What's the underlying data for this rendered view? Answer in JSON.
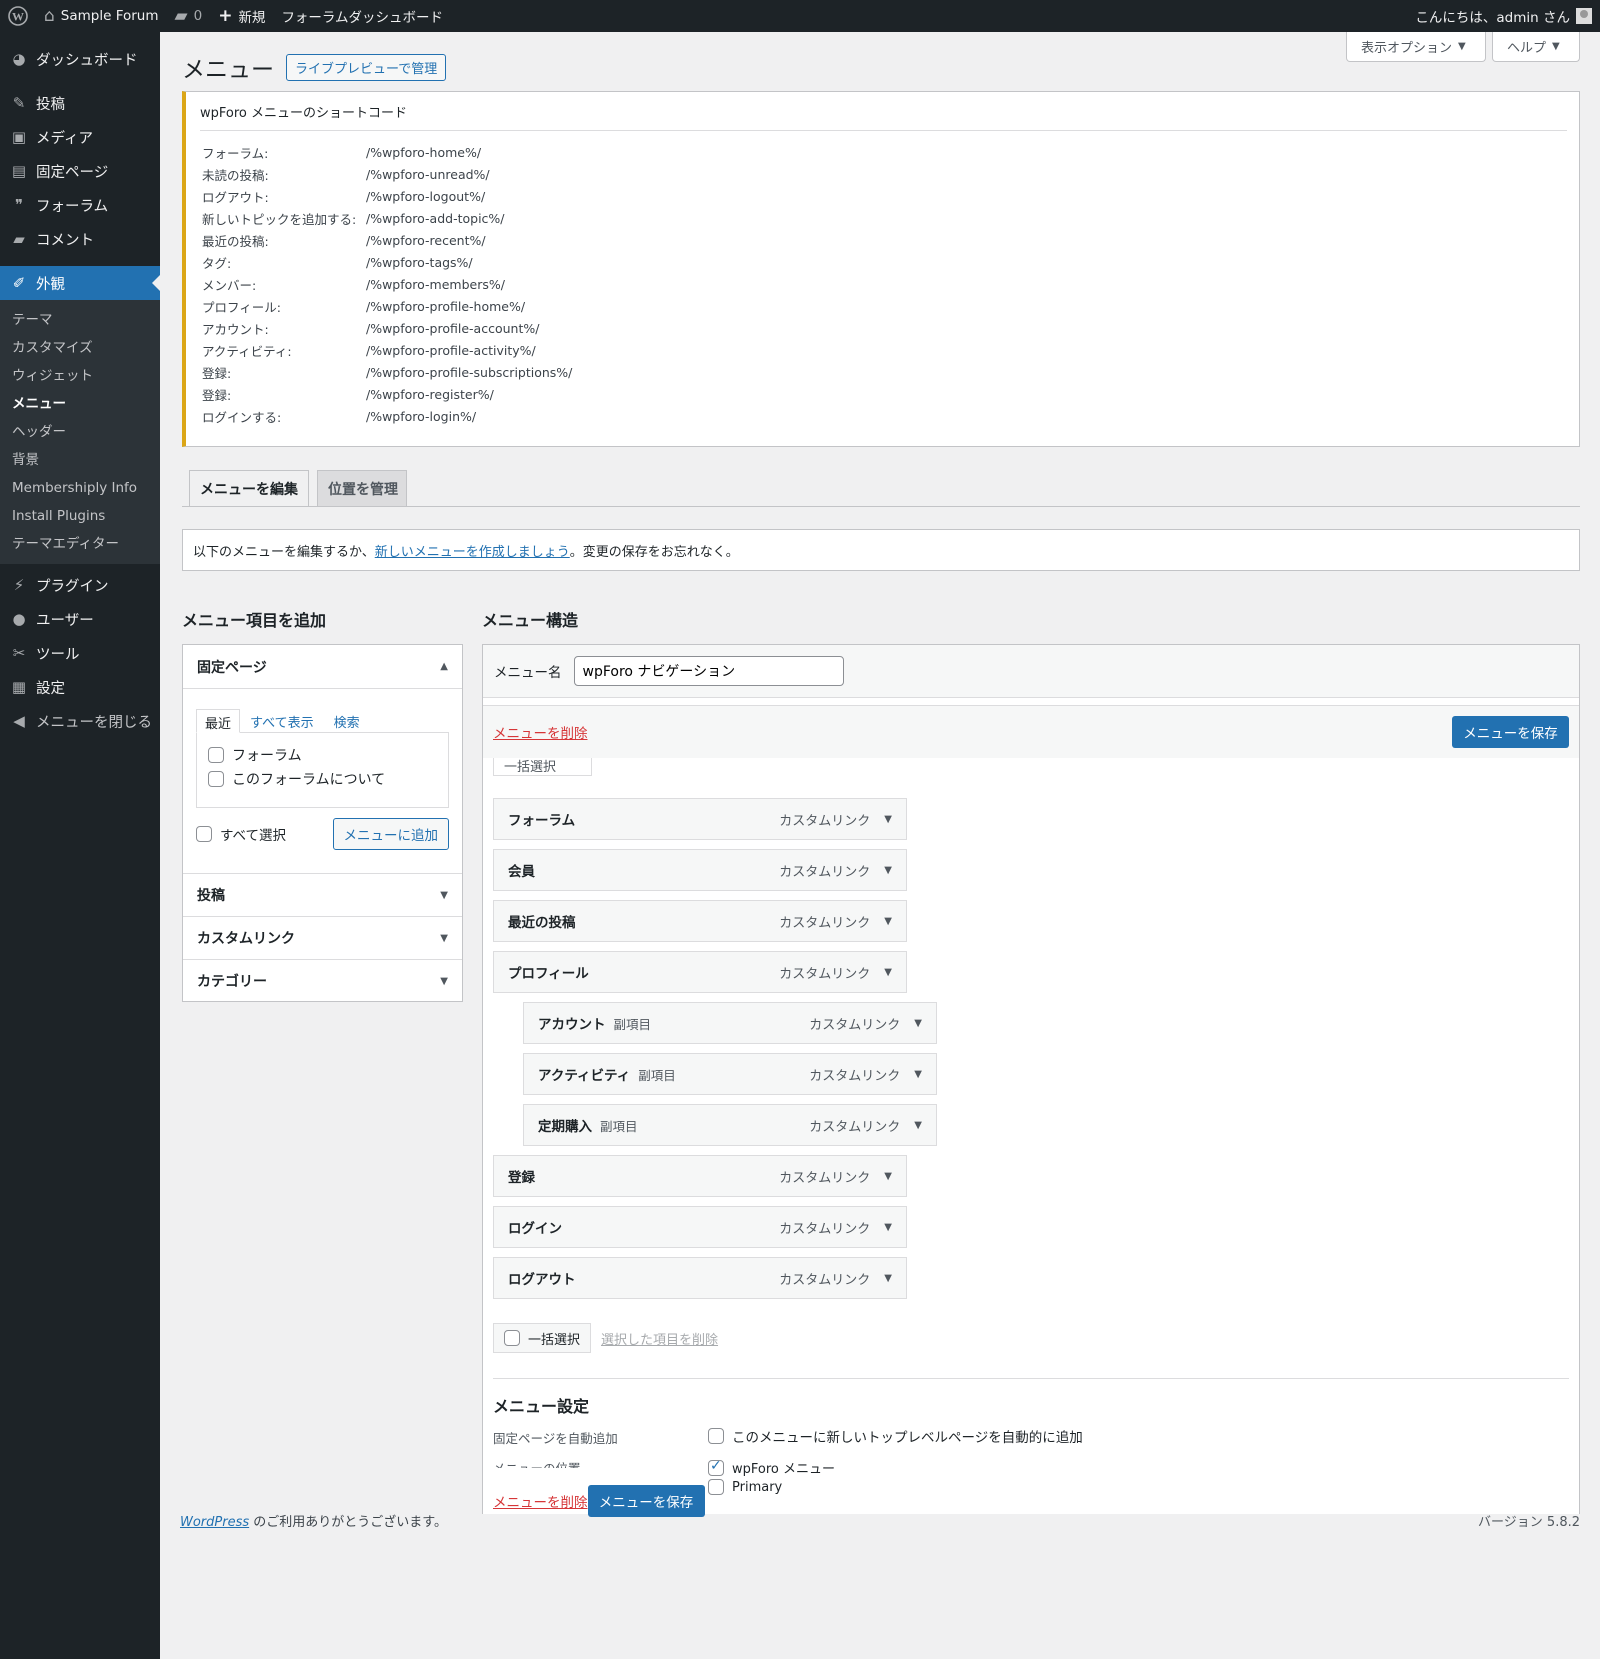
{
  "adminbar": {
    "site_name": "Sample Forum",
    "comments_count": "0",
    "new_label": "新規",
    "forum_dashboard": "フォーラムダッシュボード",
    "greeting": "こんにちは、admin さん"
  },
  "sidebar": {
    "items": [
      {
        "label": "ダッシュボード",
        "icon": "dashboard-icon"
      },
      {
        "label": "投稿",
        "icon": "pin-icon"
      },
      {
        "label": "メディア",
        "icon": "media-icon"
      },
      {
        "label": "固定ページ",
        "icon": "page-icon"
      },
      {
        "label": "フォーラム",
        "icon": "forum-icon"
      },
      {
        "label": "コメント",
        "icon": "comment-icon"
      },
      {
        "label": "外観",
        "icon": "brush-icon"
      },
      {
        "label": "プラグイン",
        "icon": "plugin-icon"
      },
      {
        "label": "ユーザー",
        "icon": "user-icon"
      },
      {
        "label": "ツール",
        "icon": "wrench-icon"
      },
      {
        "label": "設定",
        "icon": "settings-icon"
      },
      {
        "label": "メニューを閉じる",
        "icon": "collapse-icon"
      }
    ],
    "submenu": [
      "テーマ",
      "カスタマイズ",
      "ウィジェット",
      "メニュー",
      "ヘッダー",
      "背景",
      "Membershiply Info",
      "Install Plugins",
      "テーマエディター"
    ]
  },
  "header": {
    "title": "メニュー",
    "live_preview": "ライブプレビューで管理",
    "screen_options": "表示オプション",
    "help": "ヘルプ"
  },
  "shortcodes": {
    "title": "wpForo メニューのショートコード",
    "rows": [
      {
        "k": "フォーラム:",
        "v": "/%wpforo-home%/"
      },
      {
        "k": "未読の投稿:",
        "v": "/%wpforo-unread%/"
      },
      {
        "k": "ログアウト:",
        "v": "/%wpforo-logout%/"
      },
      {
        "k": "新しいトピックを追加する:",
        "v": "/%wpforo-add-topic%/"
      },
      {
        "k": "最近の投稿:",
        "v": "/%wpforo-recent%/"
      },
      {
        "k": "タグ:",
        "v": "/%wpforo-tags%/"
      },
      {
        "k": "メンバー:",
        "v": "/%wpforo-members%/"
      },
      {
        "k": "プロフィール:",
        "v": "/%wpforo-profile-home%/"
      },
      {
        "k": "アカウント:",
        "v": "/%wpforo-profile-account%/"
      },
      {
        "k": "アクティビティ:",
        "v": "/%wpforo-profile-activity%/"
      },
      {
        "k": "登録:",
        "v": "/%wpforo-profile-subscriptions%/"
      },
      {
        "k": "登録:",
        "v": "/%wpforo-register%/"
      },
      {
        "k": "ログインする:",
        "v": "/%wpforo-login%/"
      }
    ]
  },
  "tabs": {
    "edit": "メニューを編集",
    "locations": "位置を管理"
  },
  "notice": {
    "before": "以下のメニューを編集するか、",
    "link": "新しいメニューを作成しましょう",
    "after": "。変更の保存をお忘れなく。"
  },
  "add_items": {
    "heading": "メニュー項目を追加",
    "pages_title": "固定ページ",
    "subtabs": [
      "最近",
      "すべて表示",
      "検索"
    ],
    "pages": [
      "フォーラム",
      "このフォーラムについて"
    ],
    "select_all": "すべて選択",
    "add_button": "メニューに追加",
    "sections": [
      "投稿",
      "カスタムリンク",
      "カテゴリー"
    ]
  },
  "structure": {
    "heading": "メニュー構造",
    "name_label": "メニュー名",
    "name_value": "wpForo ナビゲーション",
    "delete_link": "メニューを削除",
    "save_button": "メニューを保存",
    "bulk_select": "一括選択",
    "items": [
      {
        "title": "フォーラム",
        "type": "カスタムリンク",
        "sub": ""
      },
      {
        "title": "会員",
        "type": "カスタムリンク",
        "sub": ""
      },
      {
        "title": "最近の投稿",
        "type": "カスタムリンク",
        "sub": ""
      },
      {
        "title": "プロフィール",
        "type": "カスタムリンク",
        "sub": ""
      },
      {
        "title": "アカウント",
        "type": "カスタムリンク",
        "sub": "副項目"
      },
      {
        "title": "アクティビティ",
        "type": "カスタムリンク",
        "sub": "副項目"
      },
      {
        "title": "定期購入",
        "type": "カスタムリンク",
        "sub": "副項目"
      },
      {
        "title": "登録",
        "type": "カスタムリンク",
        "sub": ""
      },
      {
        "title": "ログイン",
        "type": "カスタムリンク",
        "sub": ""
      },
      {
        "title": "ログアウト",
        "type": "カスタムリンク",
        "sub": ""
      }
    ],
    "remove_selected": "選択した項目を削除",
    "settings_heading": "メニュー設定",
    "auto_add_label": "固定ページを自動追加",
    "auto_add_option": "このメニューに新しいトップレベルページを自動的に追加",
    "location_label": "メニューの位置",
    "locations": [
      {
        "label": "wpForo メニュー",
        "checked": true
      },
      {
        "label": "Primary",
        "checked": false
      }
    ]
  },
  "footer": {
    "wp_link": "WordPress",
    "thanks": " のご利用ありがとうございます。",
    "version": "バージョン 5.8.2"
  },
  "colors": {
    "primary": "#2271b1",
    "admin_bar": "#1d2327",
    "notice_border": "#dba617",
    "delete": "#d63638"
  }
}
